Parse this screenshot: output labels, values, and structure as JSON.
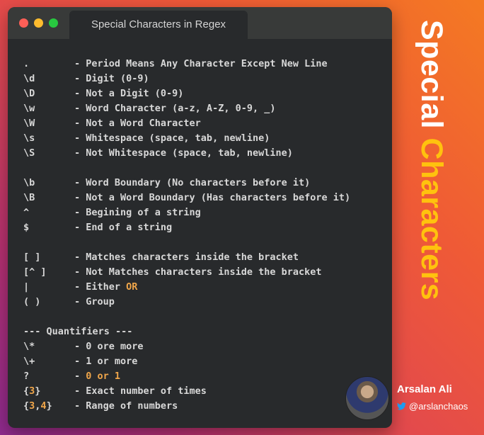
{
  "window": {
    "tab_title": "Special Characters in Regex"
  },
  "code_lines": [
    {
      "sym": ".",
      "desc": [
        {
          "t": "- Period Means Any Character Except New Line"
        }
      ]
    },
    {
      "sym": "\\d",
      "desc": [
        {
          "t": "- Digit (0-9)"
        }
      ]
    },
    {
      "sym": "\\D",
      "desc": [
        {
          "t": "- Not a Digit (0-9)"
        }
      ]
    },
    {
      "sym": "\\w",
      "desc": [
        {
          "t": "- Word Character (a-z, A-Z, 0-9, _)"
        }
      ]
    },
    {
      "sym": "\\W",
      "desc": [
        {
          "t": "- Not a Word Character"
        }
      ]
    },
    {
      "sym": "\\s",
      "desc": [
        {
          "t": "- Whitespace (space, tab, newline)"
        }
      ]
    },
    {
      "sym": "\\S",
      "desc": [
        {
          "t": "- Not Whitespace (space, tab, newline)"
        }
      ]
    },
    {
      "sym": "",
      "desc": []
    },
    {
      "sym": "\\b",
      "desc": [
        {
          "t": "- Word Boundary (No characters before it)"
        }
      ]
    },
    {
      "sym": "\\B",
      "desc": [
        {
          "t": "- Not a Word Boundary (Has characters before it)"
        }
      ]
    },
    {
      "sym": "^",
      "desc": [
        {
          "t": "- Begining of a string"
        }
      ]
    },
    {
      "sym": "$",
      "desc": [
        {
          "t": "- End of a string"
        }
      ]
    },
    {
      "sym": "",
      "desc": []
    },
    {
      "sym": "[ ]",
      "desc": [
        {
          "t": "- Matches characters inside the bracket"
        }
      ]
    },
    {
      "sym": "[^ ]",
      "desc": [
        {
          "t": "- Not Matches characters inside the bracket"
        }
      ]
    },
    {
      "sym": "|",
      "desc": [
        {
          "t": "- Either "
        },
        {
          "t": "OR",
          "hl": true
        }
      ]
    },
    {
      "sym": "( )",
      "desc": [
        {
          "t": "- Group"
        }
      ]
    },
    {
      "sym": "",
      "desc": []
    },
    {
      "full": "--- Quantifiers ---"
    },
    {
      "sym": "\\*",
      "desc": [
        {
          "t": "- 0 ore more"
        }
      ]
    },
    {
      "sym": "\\+",
      "desc": [
        {
          "t": "- 1 or more"
        }
      ]
    },
    {
      "sym": "?",
      "desc": [
        {
          "t": "- "
        },
        {
          "t": "0 or 1",
          "hl": true
        }
      ]
    },
    {
      "symParts": [
        {
          "t": "{"
        },
        {
          "t": "3",
          "hl": true
        },
        {
          "t": "}"
        }
      ],
      "desc": [
        {
          "t": "- Exact number of times"
        }
      ]
    },
    {
      "symParts": [
        {
          "t": "{"
        },
        {
          "t": "3",
          "hl": true
        },
        {
          "t": ","
        },
        {
          "t": "4",
          "hl": true
        },
        {
          "t": "}"
        }
      ],
      "desc": [
        {
          "t": "- Range of numbers"
        }
      ]
    }
  ],
  "side_title": {
    "word1": "Special",
    "word2": "Characters"
  },
  "author": {
    "name": "Arsalan Ali",
    "handle": "@arslanchaos",
    "icon": "twitter-icon"
  },
  "colors": {
    "highlight": "#f0a64a",
    "title_accent": "#ffc20e"
  }
}
